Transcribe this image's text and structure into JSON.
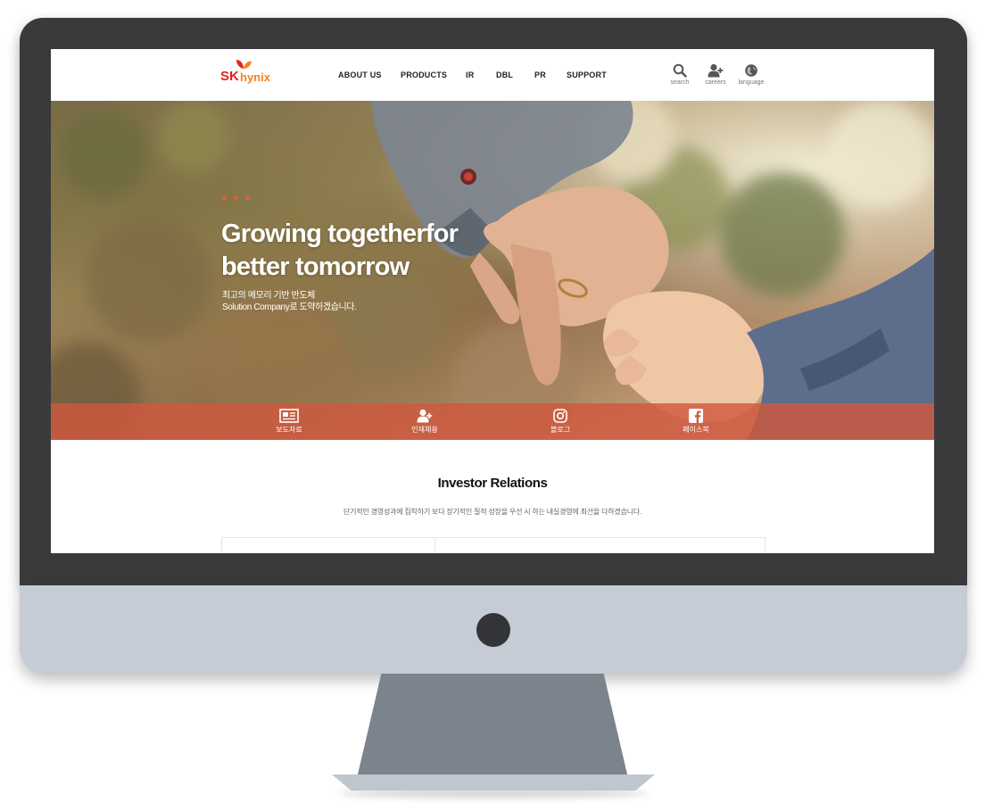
{
  "brand": {
    "sk": "SK",
    "hynix": "hynix"
  },
  "nav": [
    "ABOUT US",
    "PRODUCTS",
    "IR",
    "DBL",
    "PR",
    "SUPPORT"
  ],
  "tools": [
    {
      "label": "search",
      "icon": "search-icon"
    },
    {
      "label": "careers",
      "icon": "add-user-icon"
    },
    {
      "label": "language",
      "icon": "globe-icon"
    }
  ],
  "hero": {
    "title_line1": "Growing togetherfor",
    "title_line2": "better tomorrow",
    "subtitle_line1": "최고의 메모리 기반 반도체",
    "subtitle_line2": "Solution Company로 도약하겠습니다."
  },
  "quick_links": [
    {
      "label": "보도자료",
      "icon": "newspaper-icon"
    },
    {
      "label": "인재채용",
      "icon": "add-user-icon"
    },
    {
      "label": "블로그",
      "icon": "instagram-icon"
    },
    {
      "label": "페이스북",
      "icon": "facebook-icon"
    }
  ],
  "investor": {
    "title": "Investor Relations",
    "description": "단기적인 경영성과에 집착하기 보다 장기적인 질적 성장을 우선 시 하는 내실경영에 최선을 다하겠습니다."
  },
  "colors": {
    "accent": "#e2231a",
    "brand_orange": "#f58220",
    "quick_bar": "#d0583e",
    "bezel": "#3a3a3c",
    "chin": "#c5ccd5",
    "stand": "#7b838c"
  }
}
